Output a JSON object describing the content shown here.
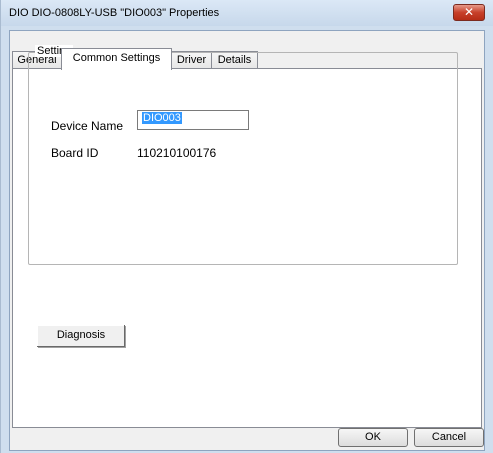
{
  "window": {
    "title": "DIO DIO-0808LY-USB \"DIO003\" Properties",
    "close_glyph": "✕"
  },
  "tabs": [
    {
      "label": "General"
    },
    {
      "label": "Common Settings"
    },
    {
      "label": "Driver"
    },
    {
      "label": "Details"
    }
  ],
  "active_tab": "Common Settings",
  "setting": {
    "group_label": "Setting",
    "device_name_label": "Device Name",
    "device_name_value": "DIO003",
    "board_id_label": "Board ID",
    "board_id_value": "110210100176"
  },
  "buttons": {
    "diagnosis": "Diagnosis",
    "ok": "OK",
    "cancel": "Cancel"
  }
}
